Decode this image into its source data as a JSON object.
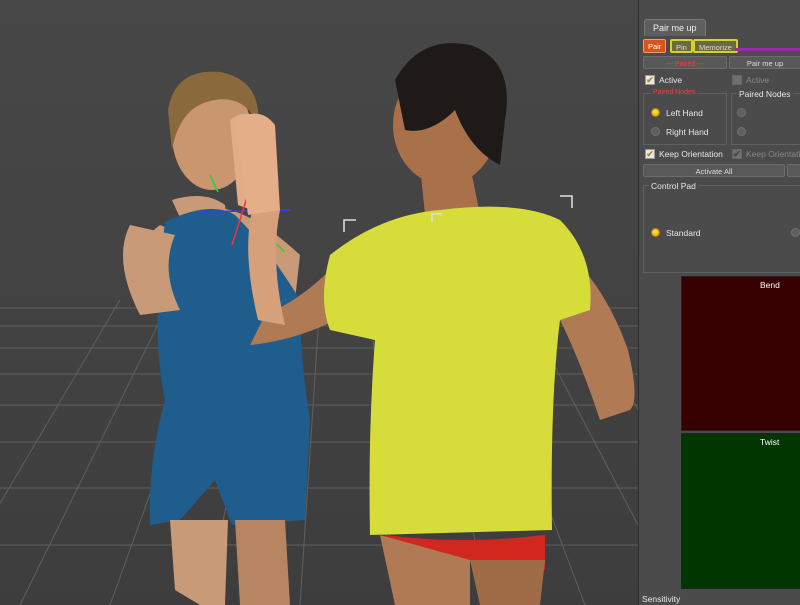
{
  "viewport": {
    "label": "3D viewport with two posed figures"
  },
  "panel": {
    "title_tab": "Pair me up",
    "tabs": {
      "pair": "Pair",
      "pin": "Pin",
      "memorize": "Memorize"
    },
    "paired_button": "--- Paired ---",
    "pair_me_up_button": "Pair me up",
    "active_label": "Active",
    "active_label_2": "Active",
    "paired_nodes_red": "Paired Nodes",
    "paired_nodes": "Paired Nodes",
    "left_hand": "Left Hand",
    "right_hand": "Right Hand",
    "keep_orientation": "Keep Orientation",
    "keep_orientation_2": "Keep Orientation",
    "activate_all": "Activate All",
    "control_pad": "Control Pad",
    "standard": "Standard",
    "bend": "Bend",
    "twist": "Twist",
    "sensitivity": "Sensitivity"
  },
  "colors": {
    "bend_pad": "#360000",
    "twist_pad": "#003600",
    "pair_tab": "#d8541a",
    "highlight_border": "#d6cf2c",
    "purple_line": "#9a2aa6"
  }
}
